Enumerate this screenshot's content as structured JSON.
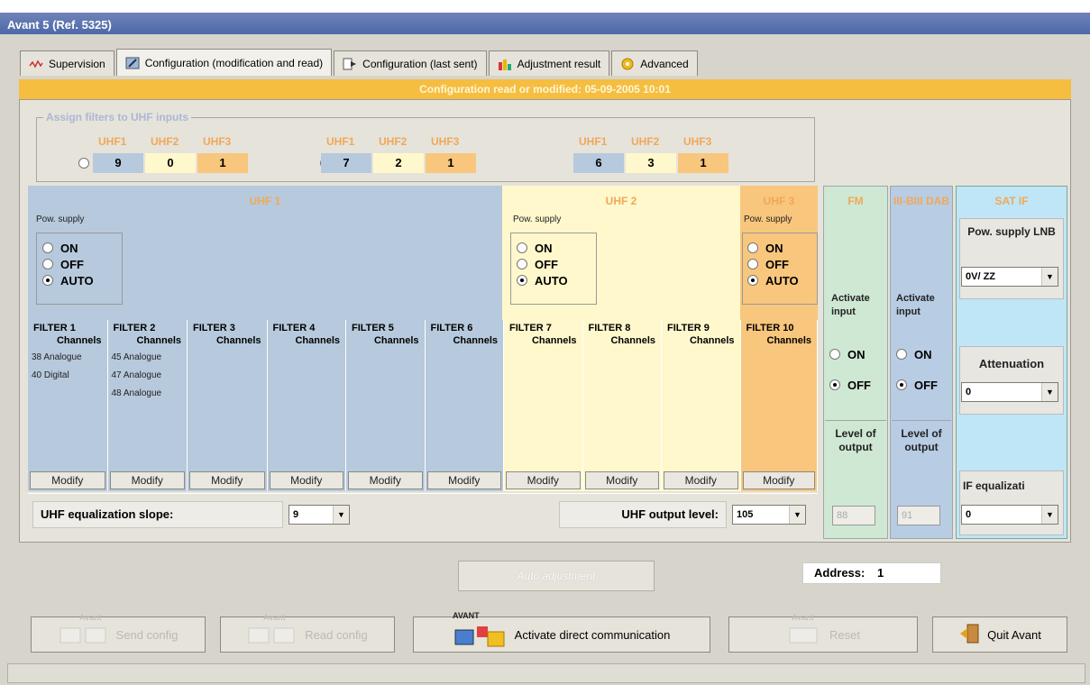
{
  "window": {
    "title": "Avant 5 (Ref. 5325)"
  },
  "tabs": [
    {
      "label": "Supervision",
      "icon": "waveform-icon"
    },
    {
      "label": "Configuration (modification and read)",
      "icon": "edit-icon"
    },
    {
      "label": "Configuration (last sent)",
      "icon": "send-arrow-icon"
    },
    {
      "label": "Adjustment result",
      "icon": "bar-chart-icon"
    },
    {
      "label": "Advanced",
      "icon": "gear-icon"
    }
  ],
  "banner": "Configuration read or modified: 05-09-2005 10:01",
  "assign": {
    "label": "Assign filters to UHF inputs",
    "headers": [
      "UHF1",
      "UHF2",
      "UHF3"
    ],
    "options": [
      {
        "values": [
          "9",
          "0",
          "1"
        ],
        "selected": false
      },
      {
        "values": [
          "7",
          "2",
          "1"
        ],
        "selected": false
      },
      {
        "values": [
          "6",
          "3",
          "1"
        ],
        "selected": true
      }
    ]
  },
  "uhf1": {
    "title": "UHF 1",
    "pow_label": "Pow. supply",
    "options": [
      "ON",
      "OFF",
      "AUTO"
    ],
    "selected": "AUTO"
  },
  "uhf2": {
    "title": "UHF 2",
    "pow_label": "Pow. supply",
    "options": [
      "ON",
      "OFF",
      "AUTO"
    ],
    "selected": "AUTO"
  },
  "uhf3": {
    "title": "UHF 3",
    "pow_label": "Pow. supply",
    "options": [
      "ON",
      "OFF",
      "AUTO"
    ],
    "selected": "AUTO"
  },
  "fm": {
    "title": "FM",
    "activate": "Activate input",
    "options": [
      "ON",
      "OFF"
    ],
    "selected": "OFF",
    "level_label": "Level of output",
    "level": "88"
  },
  "dab": {
    "title": "III-BIII DAB",
    "activate": "Activate input",
    "options": [
      "ON",
      "OFF"
    ],
    "selected": "OFF",
    "level_label": "Level of output",
    "level": "91"
  },
  "sat": {
    "title": "SAT IF",
    "pow_label": "Pow. supply LNB",
    "pow_value": "0V/ ZZ",
    "att_label": "Attenuation",
    "att_value": "0",
    "eq_label": "IF equalizati",
    "eq_value": "0"
  },
  "filters": [
    {
      "title": "FILTER 1",
      "sub": "Channels",
      "channels": [
        "38 Analogue",
        "40 Digital"
      ]
    },
    {
      "title": "FILTER 2",
      "sub": "Channels",
      "channels": [
        "45 Analogue",
        "47 Analogue",
        "48 Analogue"
      ]
    },
    {
      "title": "FILTER 3",
      "sub": "Channels",
      "channels": []
    },
    {
      "title": "FILTER 4",
      "sub": "Channels",
      "channels": []
    },
    {
      "title": "FILTER 5",
      "sub": "Channels",
      "channels": []
    },
    {
      "title": "FILTER 6",
      "sub": "Channels",
      "channels": []
    },
    {
      "title": "FILTER 7",
      "sub": "Channels",
      "channels": []
    },
    {
      "title": "FILTER 8",
      "sub": "Channels",
      "channels": []
    },
    {
      "title": "FILTER 9",
      "sub": "Channels",
      "channels": []
    },
    {
      "title": "FILTER 10",
      "sub": "Channels",
      "channels": []
    }
  ],
  "modify_label": "Modify",
  "slope": {
    "label": "UHF equalization slope:",
    "value": "9"
  },
  "outlevel": {
    "label": "UHF output level:",
    "value": "105"
  },
  "auto_adjust": "Auto adjustment",
  "address": {
    "label": "Address:",
    "value": "1"
  },
  "buttons": {
    "send": "Send config",
    "read": "Read config",
    "activate": "Activate direct communication",
    "reset": "Reset",
    "quit": "Quit Avant",
    "avant_small": "Avant",
    "avant_logo": "AVANT"
  },
  "colors": {
    "uhf1": "#b7c9dc",
    "uhf2": "#fff8cc",
    "uhf3": "#f8c67c",
    "fm": "#cfe8d4",
    "dab": "#b8cce4",
    "sat": "#bfe6f6",
    "banner": "#f5be41"
  }
}
